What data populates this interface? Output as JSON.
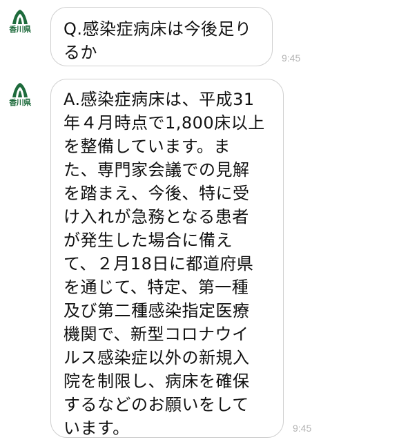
{
  "messages": [
    {
      "sender": "香川県",
      "text": "Q.感染症病床は今後足り\nるか",
      "time": "9:45"
    },
    {
      "sender": "香川県",
      "text": "A.感染症病床は、平成31\n年４月時点で1,800床以上\nを整備しています。ま\nた、専門家会議での見解\nを踏まえ、今後、特に受\nけ入れが急務となる患者\nが発生した場合に備え\nて、２月18日に都道府県\nを通じて、特定、第一種\n及び第二種感染指定医療\n機関で、新型コロナウイ\nルス感染症以外の新規入\n院を制限し、病床を確保\nするなどのお願いをして\nいます。",
      "time": "9:45"
    }
  ],
  "colors": {
    "logo_green": "#1e6b3c",
    "bubble_border": "#cfcfcf",
    "timestamp": "#b4b4b4"
  }
}
